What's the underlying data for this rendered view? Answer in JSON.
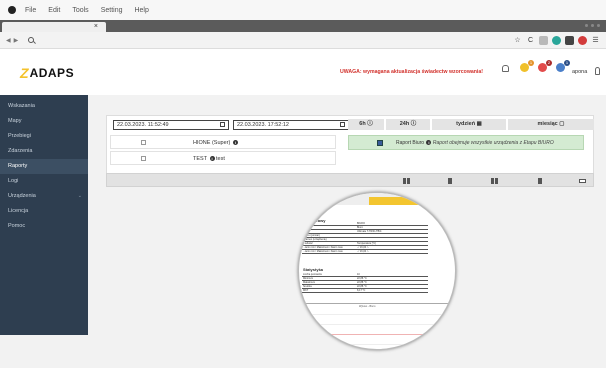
{
  "os_menu": {
    "items": [
      "File",
      "Edit",
      "Tools",
      "Setting",
      "Help"
    ]
  },
  "browser": {
    "tab_close": "×",
    "back": "◀",
    "forward": "▶",
    "url_value": ""
  },
  "header": {
    "logo_text": "ADAPS",
    "warning": "UWAGA: wymagana aktualizacja świadectw wzorcowania!",
    "notification_badges": [
      "1",
      "2",
      "1"
    ],
    "user_name": "apona"
  },
  "sidebar": {
    "items": [
      {
        "label": "Wskazania",
        "active": false,
        "chevron": false
      },
      {
        "label": "Mapy",
        "active": false,
        "chevron": false
      },
      {
        "label": "Przebiegi",
        "active": false,
        "chevron": false
      },
      {
        "label": "Zdarzenia",
        "active": false,
        "chevron": false
      },
      {
        "label": "Raporty",
        "active": true,
        "chevron": false
      },
      {
        "label": "Logi",
        "active": false,
        "chevron": false
      },
      {
        "label": "Urządzenia",
        "active": false,
        "chevron": true
      },
      {
        "label": "Licencja",
        "active": false,
        "chevron": false
      },
      {
        "label": "Pomoc",
        "active": false,
        "chevron": false
      }
    ]
  },
  "report": {
    "date_from": "22.03.2023. 11:52:49",
    "date_to": "22.03.2023. 17:52:12",
    "ranges": [
      "6h ⓘ",
      "24h ⓘ",
      "tydzień ▦",
      "miesiąc ▢"
    ],
    "devices": [
      {
        "name": "HIONE (Super)",
        "checked": false
      },
      {
        "name": "TEST",
        "suffix": "test",
        "checked": false
      }
    ],
    "report_label": "Raport Biuro",
    "report_note": "Raport obejmuje wszystkie urządzenia z Etapu BIURO",
    "action_count": 5
  },
  "preview": {
    "title": "...rawy",
    "rows": [
      {
        "label": "",
        "value": "BIURO"
      },
      {
        "label": "",
        "value": "Biuro"
      },
      {
        "label": "",
        "value": "Ultimate T-Hi/3C-TB/4"
      },
      {
        "label": "...mex (pomiar)",
        "value": ""
      },
      {
        "label": "...ramex (urządzenie)",
        "value": ""
      },
      {
        "label": "...ielkość",
        "value": "Temperatura [°C]"
      },
      {
        "label": "...larm min / Maksimum / Alarm max",
        "value": "- / 16,00 / -"
      },
      {
        "label": "...larm min / Maksimum / Alarm max",
        "value": "- / 16,00 / -"
      }
    ],
    "stats_title": "Statystyka",
    "stats": [
      {
        "label": "Liczba pomiarów",
        "value": "10"
      },
      {
        "label": "Minimum",
        "value": "22,88 °C"
      },
      {
        "label": "Maksimum",
        "value": "22,88 °C"
      },
      {
        "label": "Średnia",
        "value": "22,88 °C"
      },
      {
        "label": "MKT",
        "value": "8,17 °C"
      }
    ],
    "chart_title": "Wykres - Biuro"
  }
}
